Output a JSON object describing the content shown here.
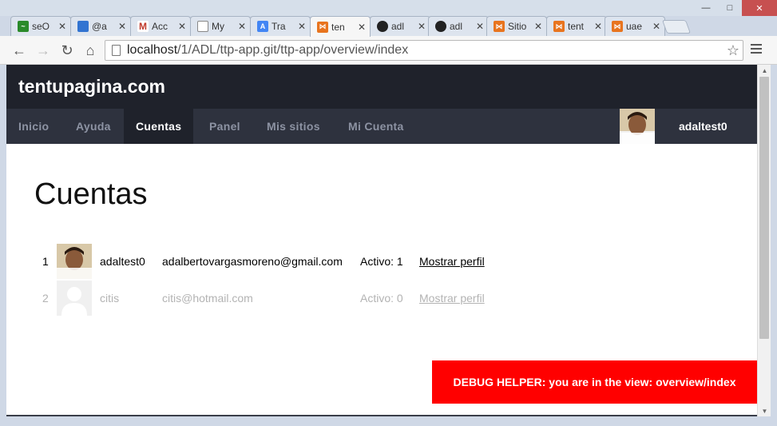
{
  "browser": {
    "tabs": [
      {
        "title": "seO",
        "icon": "chart-icon",
        "color": "#2a8a2a"
      },
      {
        "title": "@a",
        "icon": "delicious-icon",
        "color": "#3274d1"
      },
      {
        "title": "Acc",
        "icon": "gmail-icon",
        "color": "#c0392b"
      },
      {
        "title": "My",
        "icon": "page-icon",
        "color": "#888888"
      },
      {
        "title": "Tra",
        "icon": "translate-icon",
        "color": "#4285f4"
      },
      {
        "title": "ten",
        "icon": "xampp-icon",
        "color": "#e8741e",
        "active": true
      },
      {
        "title": "adl",
        "icon": "github-icon",
        "color": "#222222"
      },
      {
        "title": "adl",
        "icon": "github-icon",
        "color": "#222222"
      },
      {
        "title": "Sitio",
        "icon": "xampp-icon",
        "color": "#e8741e"
      },
      {
        "title": "tent",
        "icon": "xampp-icon",
        "color": "#e8741e"
      },
      {
        "title": "uae",
        "icon": "xampp-icon",
        "color": "#e8741e"
      }
    ],
    "url_host": "localhost",
    "url_path": "/1/ADL/ttp-app.git/ttp-app/overview/index"
  },
  "site": {
    "title": "tentupagina.com",
    "nav": [
      {
        "label": "Inicio"
      },
      {
        "label": "Ayuda"
      },
      {
        "label": "Cuentas",
        "active": true
      },
      {
        "label": "Panel"
      },
      {
        "label": "Mis sitios"
      },
      {
        "label": "Mi Cuenta"
      }
    ],
    "username": "adaltest0"
  },
  "page": {
    "heading": "Cuentas",
    "accounts": [
      {
        "index": "1",
        "username": "adaltest0",
        "email": "adalbertovargasmoreno@gmail.com",
        "status": "Activo: 1",
        "link": "Mostrar perfil",
        "avatar": "photo"
      },
      {
        "index": "2",
        "username": "citis",
        "email": "citis@hotmail.com",
        "status": "Activo: 0",
        "link": "Mostrar perfil",
        "avatar": "default"
      }
    ]
  },
  "debug": {
    "text": "DEBUG HELPER: you are in the view: overview/index",
    "color": "#ff0000"
  }
}
